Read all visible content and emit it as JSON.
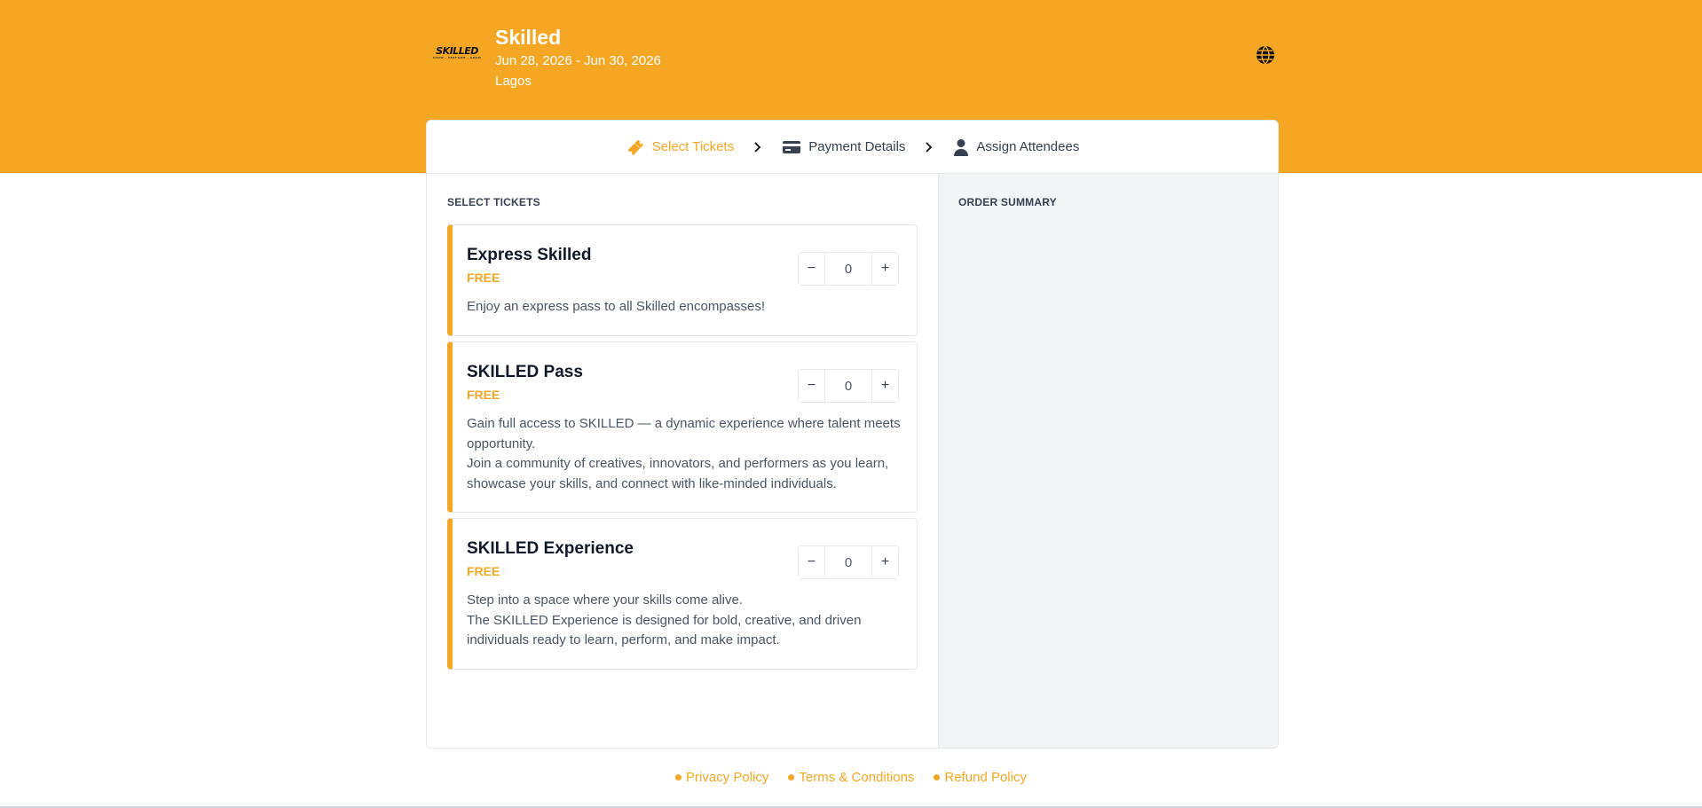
{
  "event": {
    "logo_text": "SKILLED",
    "logo_tagline": "SHOW · PERFORM · GROW",
    "title": "Skilled",
    "dates": "Jun 28, 2026 - Jun 30, 2026",
    "location": "Lagos"
  },
  "steps": [
    {
      "label": "Select Tickets",
      "icon": "ticket-icon",
      "active": true
    },
    {
      "label": "Payment Details",
      "icon": "credit-card-icon",
      "active": false
    },
    {
      "label": "Assign Attendees",
      "icon": "user-icon",
      "active": false
    }
  ],
  "select_tickets": {
    "heading": "SELECT TICKETS",
    "tickets": [
      {
        "name": "Express Skilled",
        "price": "FREE",
        "quantity": "0",
        "description": "Enjoy an express pass to all Skilled encompasses!"
      },
      {
        "name": "SKILLED Pass",
        "price": "FREE",
        "quantity": "0",
        "description_lines": [
          "Gain full access to SKILLED — a dynamic experience where talent meets opportunity.",
          "Join a community of creatives, innovators, and performers as you learn, showcase your skills, and connect with like-minded individuals."
        ]
      },
      {
        "name": "SKILLED Experience",
        "price": "FREE",
        "quantity": "0",
        "description_lines": [
          "Step into a space where your skills come alive.",
          "The SKILLED Experience is designed for bold, creative, and driven individuals ready to learn, perform, and make impact."
        ]
      }
    ],
    "minus_label": "−",
    "plus_label": "+"
  },
  "order_summary": {
    "heading": "ORDER SUMMARY"
  },
  "footer": {
    "privacy": "Privacy Policy",
    "terms": "Terms & Conditions",
    "refund": "Refund Policy"
  },
  "colors": {
    "accent": "#f5a623",
    "panel": "#f3f4f6"
  }
}
